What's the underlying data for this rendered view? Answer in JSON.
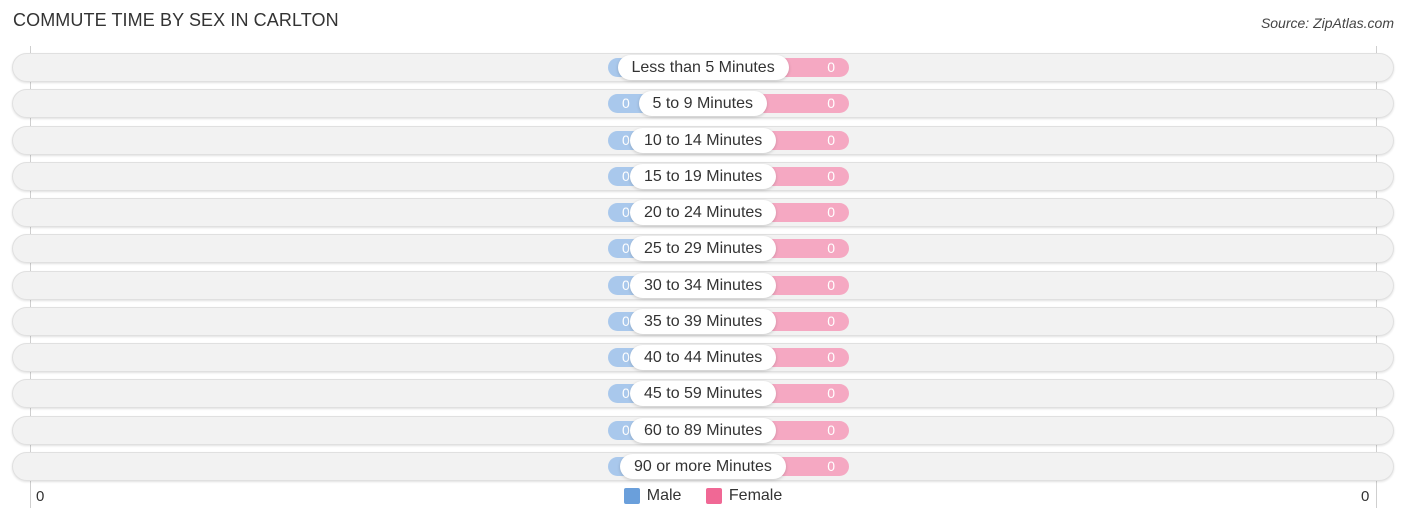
{
  "title": "COMMUTE TIME BY SEX IN CARLTON",
  "source": "Source: ZipAtlas.com",
  "colors": {
    "male_bar": "#a9c8ec",
    "female_bar": "#f5a8c2",
    "male_legend": "#6a9fdb",
    "female_legend": "#f06895"
  },
  "chart_data": {
    "type": "bar",
    "orientation": "horizontal-diverging",
    "title": "COMMUTE TIME BY SEX IN CARLTON",
    "categories": [
      "Less than 5 Minutes",
      "5 to 9 Minutes",
      "10 to 14 Minutes",
      "15 to 19 Minutes",
      "20 to 24 Minutes",
      "25 to 29 Minutes",
      "30 to 34 Minutes",
      "35 to 39 Minutes",
      "40 to 44 Minutes",
      "45 to 59 Minutes",
      "60 to 89 Minutes",
      "90 or more Minutes"
    ],
    "series": [
      {
        "name": "Male",
        "values": [
          0,
          0,
          0,
          0,
          0,
          0,
          0,
          0,
          0,
          0,
          0,
          0
        ]
      },
      {
        "name": "Female",
        "values": [
          0,
          0,
          0,
          0,
          0,
          0,
          0,
          0,
          0,
          0,
          0,
          0
        ]
      }
    ],
    "axis": {
      "left_tick": "0",
      "right_tick": "0"
    },
    "legend": [
      "Male",
      "Female"
    ],
    "legend_position": "bottom-center"
  }
}
